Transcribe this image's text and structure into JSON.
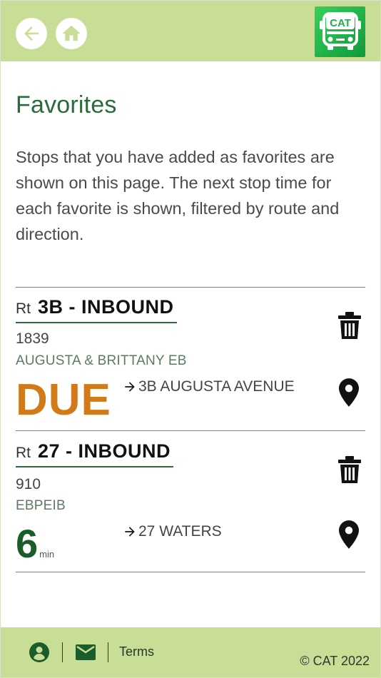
{
  "header": {
    "back_icon": "arrow-left-icon",
    "home_icon": "home-icon",
    "logo_text": "CAT"
  },
  "page": {
    "title": "Favorites",
    "intro": "Stops that you have added as favorites are shown on this page. The next stop time for each favorite is shown, filtered by route and direction."
  },
  "favorites": [
    {
      "rt_label": "Rt",
      "route": "3B - INBOUND",
      "stop_number": "1839",
      "stop_name": "AUGUSTA & BRITTANY EB",
      "arrival": "DUE",
      "destination": "3B AUGUSTA AVENUE",
      "delete_icon": "trash-icon",
      "map_icon": "map-pin-icon"
    },
    {
      "rt_label": "Rt",
      "route": "27 - INBOUND",
      "stop_number": "910",
      "stop_name": "EBPEIB",
      "arrival": "6",
      "arrival_unit": "min",
      "destination": "27 WATERS",
      "delete_icon": "trash-icon",
      "map_icon": "map-pin-icon"
    }
  ],
  "footer": {
    "account_icon": "account-icon",
    "mail_icon": "mail-icon",
    "terms": "Terms",
    "copyright": "© CAT 2022"
  },
  "colors": {
    "header_bg": "#c8de96",
    "title_green": "#2a6a3b",
    "due_orange": "#d07a1a",
    "minutes_green": "#1a5c2a",
    "logo_green": "#1fb14a"
  }
}
